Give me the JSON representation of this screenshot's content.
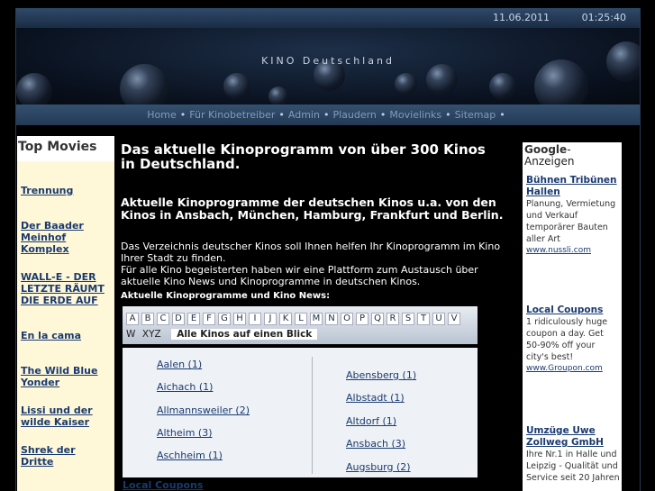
{
  "topbar": {
    "date": "11.06.2011",
    "time": "01:25:40"
  },
  "banner": {
    "title": "KINO Deutschland"
  },
  "nav": [
    {
      "label": "Home"
    },
    {
      "label": "Für Kinobetreiber"
    },
    {
      "label": "Admin"
    },
    {
      "label": "Plaudern"
    },
    {
      "label": "Movielinks"
    },
    {
      "label": "Sitemap"
    }
  ],
  "left": {
    "heading": "Top Movies",
    "items": [
      "Trennung",
      "Der Baader Meinhof Komplex",
      "WALL-E - DER LETZTE RÄUMT DIE ERDE AUF",
      "En la cama",
      "The Wild Blue Yonder",
      "Lissi und der wilde Kaiser",
      "Shrek der Dritte"
    ]
  },
  "main": {
    "title": "Das aktuelle Kinoprogramm von über 300 Kinos in Deutschland.",
    "subtitle": "Aktuelle Kinoprogramme der deutschen Kinos u.a. von den Kinos in Ansbach, München, Hamburg, Frankfurt und Berlin.",
    "para1": "Das Verzeichnis deutscher Kinos soll Ihnen helfen Ihr Kinoprogramm im Kino Ihrer Stadt zu finden.",
    "para2": "Für alle Kino begeisterten haben wir eine Plattform zum Austausch über aktuelle Kino News und Kinoprogramme in deutschen Kinos.",
    "section": "Aktuelle Kinoprogramme und Kino News:",
    "letters": [
      "A",
      "B",
      "C",
      "D",
      "E",
      "F",
      "G",
      "H",
      "I",
      "J",
      "K",
      "L",
      "M",
      "N",
      "O",
      "P",
      "Q",
      "R",
      "S",
      "T",
      "U",
      "V"
    ],
    "letters2": [
      "W",
      "XYZ"
    ],
    "all_label": "Alle Kinos auf einen Blick",
    "cities_left": [
      "Aalen (1)",
      "Aichach (1)",
      "Allmannsweiler (2)",
      "Altheim (3)",
      "Aschheim (1)"
    ],
    "cities_right": [
      "Abensberg (1)",
      "Albstadt (1)",
      "Altdorf (1)",
      "Ansbach (3)",
      "Augsburg (2)"
    ],
    "local_coupons": "Local Coupons"
  },
  "right": {
    "google_logo": "Google",
    "google_suffix": "-Anzeigen",
    "ads": [
      {
        "title": "Bühnen Tribünen Hallen",
        "text": "Planung, Vermietung und Verkauf temporärer Bauten aller Art",
        "url": "www.nussli.com"
      },
      {
        "title": "Local Coupons",
        "text": "1 ridiculously huge coupon a day. Get 50-90% off your city's best!",
        "url": "www.Groupon.com"
      },
      {
        "title": "Umzüge Uwe Zollweg GmbH",
        "text": "Ihre Nr.1 in Halle und Leipzig - Qualität und Service seit 20 Jahren",
        "url": ""
      }
    ]
  }
}
